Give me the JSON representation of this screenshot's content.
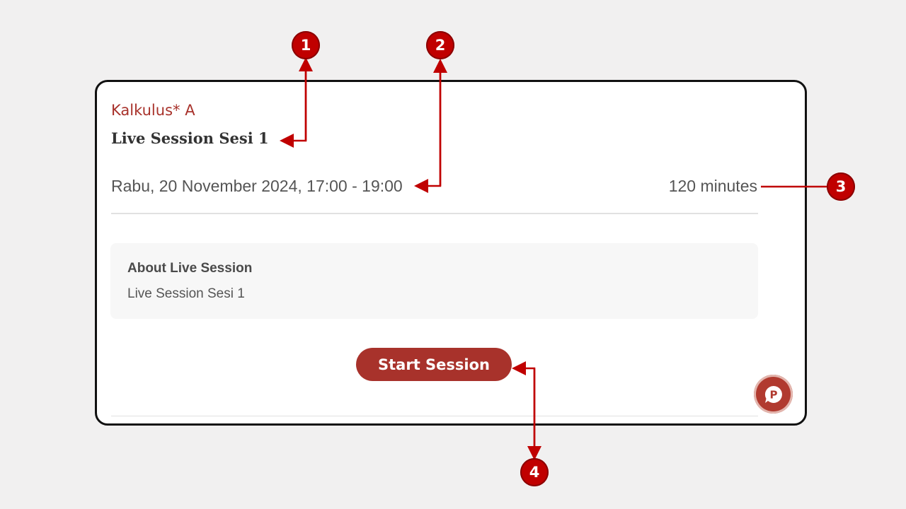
{
  "session": {
    "course": "Kalkulus* A",
    "title": "Live Session Sesi 1",
    "datetime": "Rabu, 20 November 2024, 17:00 - 19:00",
    "duration": "120 minutes"
  },
  "about": {
    "heading": "About Live Session",
    "body": "Live Session Sesi 1"
  },
  "actions": {
    "start_label": "Start Session"
  },
  "chat_widget": {
    "icon": "chat-bubble-p-icon",
    "glyph": "P"
  },
  "annotations": {
    "markers": [
      "1",
      "2",
      "3",
      "4"
    ],
    "color": "#c00000"
  },
  "colors": {
    "accent": "#a8322b",
    "background": "#f1f0f0",
    "card": "#ffffff"
  }
}
